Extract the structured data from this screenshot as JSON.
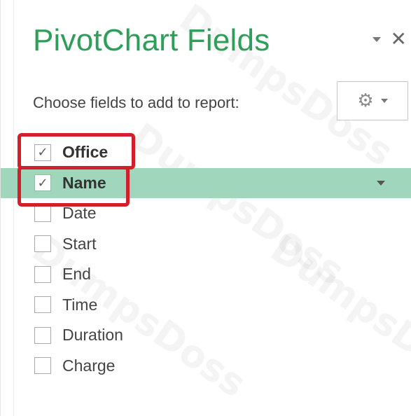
{
  "pane": {
    "title": "PivotChart Fields",
    "subtitle": "Choose fields to add to report:",
    "accent_color": "#2e9e59",
    "highlight_color": "#9fd6bc",
    "annotation_color": "#d31f2b"
  },
  "controls": {
    "dropdown_icon": "chevron-down-icon",
    "close_icon": "close-icon",
    "close_glyph": "✕",
    "tools_icon": "gear-icon",
    "gear_glyph": "⚙"
  },
  "fields": [
    {
      "label": "Office",
      "checked": true,
      "bold": true,
      "highlighted": false
    },
    {
      "label": "Name",
      "checked": true,
      "bold": true,
      "highlighted": true
    },
    {
      "label": "Date",
      "checked": false,
      "bold": false,
      "highlighted": false
    },
    {
      "label": "Start",
      "checked": false,
      "bold": false,
      "highlighted": false
    },
    {
      "label": "End",
      "checked": false,
      "bold": false,
      "highlighted": false
    },
    {
      "label": "Time",
      "checked": false,
      "bold": false,
      "highlighted": false
    },
    {
      "label": "Duration",
      "checked": false,
      "bold": false,
      "highlighted": false
    },
    {
      "label": "Charge",
      "checked": false,
      "bold": false,
      "highlighted": false
    }
  ],
  "check_glyph": "✓",
  "watermark": "DumpsDoss"
}
